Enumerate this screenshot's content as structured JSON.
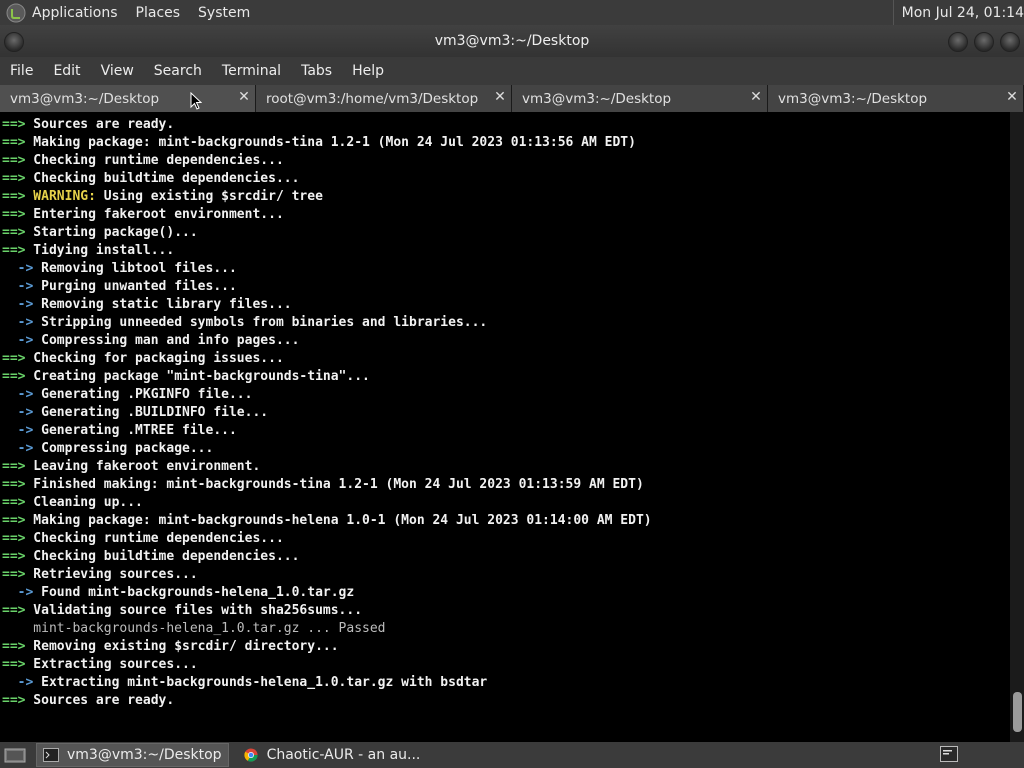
{
  "top_panel": {
    "menu_items": [
      "Applications",
      "Places",
      "System"
    ],
    "clock": "Mon Jul 24, 01:14"
  },
  "window": {
    "title": "vm3@vm3:~/Desktop"
  },
  "menubar": {
    "items": [
      "File",
      "Edit",
      "View",
      "Search",
      "Terminal",
      "Tabs",
      "Help"
    ]
  },
  "tabs": [
    {
      "label": "vm3@vm3:~/Desktop",
      "active": true
    },
    {
      "label": "root@vm3:/home/vm3/Desktop",
      "active": false
    },
    {
      "label": "vm3@vm3:~/Desktop",
      "active": false
    },
    {
      "label": "vm3@vm3:~/Desktop",
      "active": false
    }
  ],
  "terminal": {
    "lines": [
      {
        "prefix": "==>",
        "kind": "main",
        "text": " Sources are ready."
      },
      {
        "prefix": "==>",
        "kind": "main",
        "text": " Making package: mint-backgrounds-tina 1.2-1 (Mon 24 Jul 2023 01:13:56 AM EDT)"
      },
      {
        "prefix": "==>",
        "kind": "main",
        "text": " Checking runtime dependencies..."
      },
      {
        "prefix": "==>",
        "kind": "main",
        "text": " Checking buildtime dependencies..."
      },
      {
        "prefix": "==>",
        "kind": "warn",
        "label": " WARNING:",
        "text": " Using existing $srcdir/ tree"
      },
      {
        "prefix": "==>",
        "kind": "main",
        "text": " Entering fakeroot environment..."
      },
      {
        "prefix": "==>",
        "kind": "main",
        "text": " Starting package()..."
      },
      {
        "prefix": "==>",
        "kind": "main",
        "text": " Tidying install..."
      },
      {
        "prefix": "  ->",
        "kind": "sub",
        "text": " Removing libtool files..."
      },
      {
        "prefix": "  ->",
        "kind": "sub",
        "text": " Purging unwanted files..."
      },
      {
        "prefix": "  ->",
        "kind": "sub",
        "text": " Removing static library files..."
      },
      {
        "prefix": "  ->",
        "kind": "sub",
        "text": " Stripping unneeded symbols from binaries and libraries..."
      },
      {
        "prefix": "  ->",
        "kind": "sub",
        "text": " Compressing man and info pages..."
      },
      {
        "prefix": "==>",
        "kind": "main",
        "text": " Checking for packaging issues..."
      },
      {
        "prefix": "==>",
        "kind": "main",
        "text": " Creating package \"mint-backgrounds-tina\"..."
      },
      {
        "prefix": "  ->",
        "kind": "sub",
        "text": " Generating .PKGINFO file..."
      },
      {
        "prefix": "  ->",
        "kind": "sub",
        "text": " Generating .BUILDINFO file..."
      },
      {
        "prefix": "  ->",
        "kind": "sub",
        "text": " Generating .MTREE file..."
      },
      {
        "prefix": "  ->",
        "kind": "sub",
        "text": " Compressing package..."
      },
      {
        "prefix": "==>",
        "kind": "main",
        "text": " Leaving fakeroot environment."
      },
      {
        "prefix": "==>",
        "kind": "main",
        "text": " Finished making: mint-backgrounds-tina 1.2-1 (Mon 24 Jul 2023 01:13:59 AM EDT)"
      },
      {
        "prefix": "==>",
        "kind": "main",
        "text": " Cleaning up..."
      },
      {
        "prefix": "==>",
        "kind": "main",
        "text": " Making package: mint-backgrounds-helena 1.0-1 (Mon 24 Jul 2023 01:14:00 AM EDT)"
      },
      {
        "prefix": "==>",
        "kind": "main",
        "text": " Checking runtime dependencies..."
      },
      {
        "prefix": "==>",
        "kind": "main",
        "text": " Checking buildtime dependencies..."
      },
      {
        "prefix": "==>",
        "kind": "main",
        "text": " Retrieving sources..."
      },
      {
        "prefix": "  ->",
        "kind": "sub",
        "text": " Found mint-backgrounds-helena_1.0.tar.gz"
      },
      {
        "prefix": "==>",
        "kind": "main",
        "text": " Validating source files with sha256sums..."
      },
      {
        "prefix": "",
        "kind": "plain",
        "text": "    mint-backgrounds-helena_1.0.tar.gz ... Passed"
      },
      {
        "prefix": "==>",
        "kind": "main",
        "text": " Removing existing $srcdir/ directory..."
      },
      {
        "prefix": "==>",
        "kind": "main",
        "text": " Extracting sources..."
      },
      {
        "prefix": "  ->",
        "kind": "sub",
        "text": " Extracting mint-backgrounds-helena_1.0.tar.gz with bsdtar"
      },
      {
        "prefix": "==>",
        "kind": "main",
        "text": " Sources are ready."
      }
    ]
  },
  "taskbar": {
    "tasks": [
      {
        "label": "vm3@vm3:~/Desktop",
        "icon": "terminal-icon",
        "active": true
      },
      {
        "label": "Chaotic-AUR - an au...",
        "icon": "chrome-icon",
        "active": false
      }
    ]
  },
  "colors": {
    "arrow_green": "#6ad36a",
    "sub_blue": "#5b9bd5",
    "warning_yellow": "#e6d24a"
  }
}
